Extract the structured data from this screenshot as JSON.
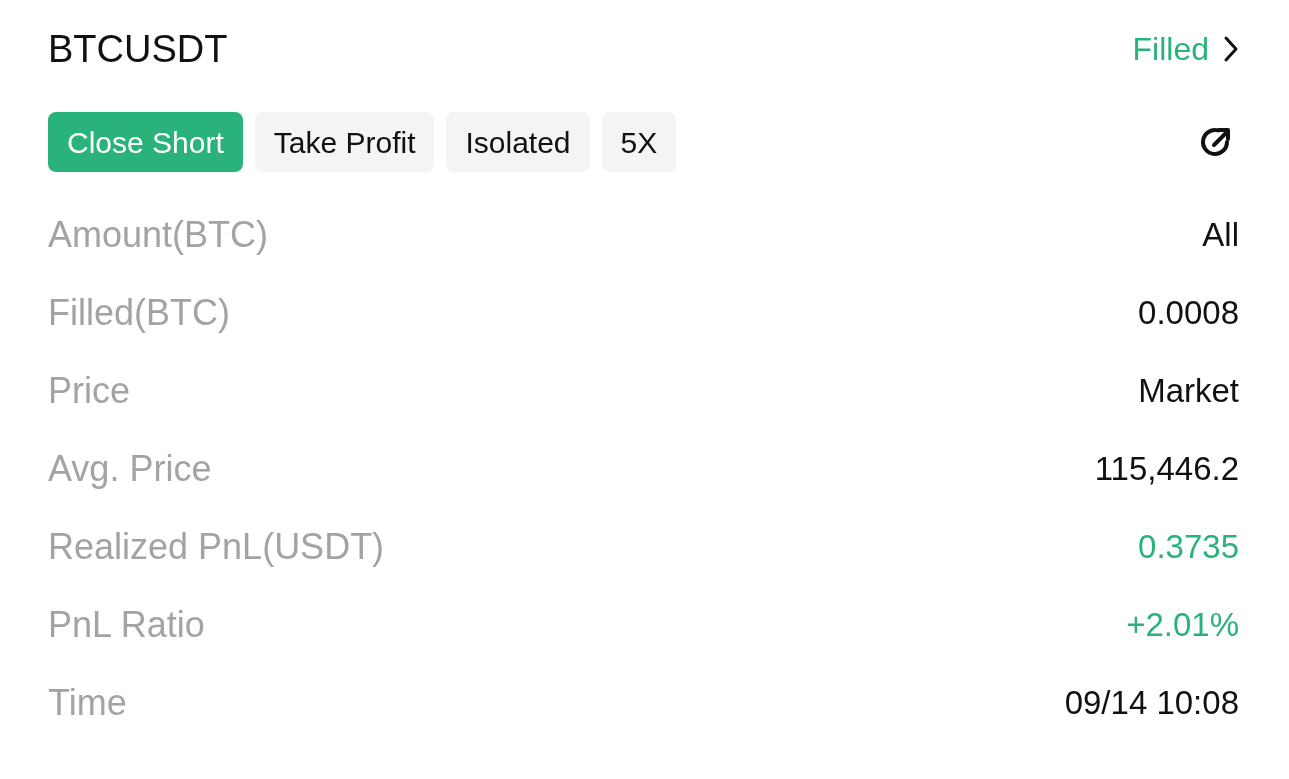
{
  "header": {
    "symbol": "BTCUSDT",
    "status": "Filled"
  },
  "tags": [
    {
      "label": "Close Short",
      "kind": "side"
    },
    {
      "label": "Take Profit",
      "kind": "plain"
    },
    {
      "label": "Isolated",
      "kind": "plain"
    },
    {
      "label": "5X",
      "kind": "plain"
    }
  ],
  "rows": [
    {
      "label": "Amount(BTC)",
      "value": "All",
      "kind": "neutral"
    },
    {
      "label": "Filled(BTC)",
      "value": "0.0008",
      "kind": "neutral"
    },
    {
      "label": "Price",
      "value": "Market",
      "kind": "neutral"
    },
    {
      "label": "Avg. Price",
      "value": "115,446.2",
      "kind": "neutral"
    },
    {
      "label": "Realized PnL(USDT)",
      "value": "0.3735",
      "kind": "positive"
    },
    {
      "label": "PnL Ratio",
      "value": "+2.01%",
      "kind": "positive"
    },
    {
      "label": "Time",
      "value": "09/14 10:08",
      "kind": "neutral"
    }
  ]
}
